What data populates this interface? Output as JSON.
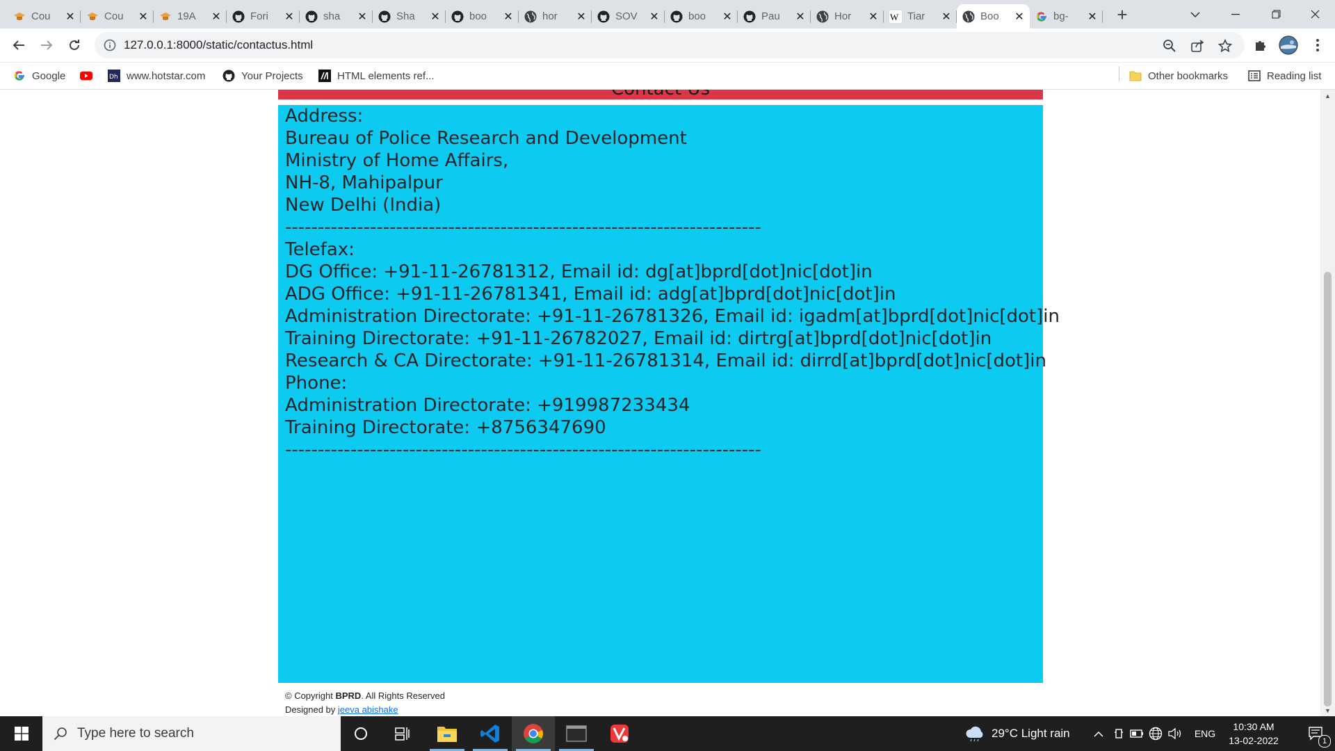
{
  "browser": {
    "tabs": [
      {
        "title": "Cou",
        "icon": "scholar-cap-icon",
        "active": false
      },
      {
        "title": "Cou",
        "icon": "scholar-cap-icon",
        "active": false
      },
      {
        "title": "19A",
        "icon": "scholar-cap-icon",
        "active": false
      },
      {
        "title": "Fori",
        "icon": "github-icon",
        "active": false
      },
      {
        "title": "sha",
        "icon": "github-icon",
        "active": false
      },
      {
        "title": "Sha",
        "icon": "github-icon",
        "active": false
      },
      {
        "title": "boo",
        "icon": "github-icon",
        "active": false
      },
      {
        "title": "hor",
        "icon": "globe-icon",
        "active": false
      },
      {
        "title": "SOV",
        "icon": "github-icon",
        "active": false
      },
      {
        "title": "boo",
        "icon": "github-icon",
        "active": false
      },
      {
        "title": "Pau",
        "icon": "github-icon",
        "active": false
      },
      {
        "title": "Hor",
        "icon": "globe-icon",
        "active": false
      },
      {
        "title": "Tiar",
        "icon": "wikipedia-icon",
        "active": false
      },
      {
        "title": "Boo",
        "icon": "globe-icon",
        "active": true
      },
      {
        "title": "bg-",
        "icon": "google-icon",
        "active": false
      }
    ],
    "url": "127.0.0.1:8000/static/contactus.html",
    "bookmarks": [
      {
        "label": "Google",
        "icon": "google-icon"
      },
      {
        "label": "",
        "icon": "youtube-icon"
      },
      {
        "label": "www.hotstar.com",
        "icon": "hotstar-icon"
      },
      {
        "label": "Your Projects",
        "icon": "github-icon"
      },
      {
        "label": "HTML elements ref...",
        "icon": "mdn-icon"
      }
    ],
    "other_bookmarks": "Other bookmarks",
    "reading_list": "Reading list"
  },
  "page": {
    "header_title": "Contact Us",
    "contact_lines": [
      "Address:",
      "Bureau of Police Research and Development",
      "Ministry of Home Affairs,",
      "NH-8, Mahipalpur",
      "New Delhi (India)",
      "-------------------------------------------------------------------------",
      "Telefax:",
      "DG Office: +91-11-26781312, Email id: dg[at]bprd[dot]nic[dot]in",
      "ADG Office: +91-11-26781341, Email id: adg[at]bprd[dot]nic[dot]in",
      "Administration Directorate: +91-11-26781326, Email id: igadm[at]bprd[dot]nic[dot]in",
      "Training Directorate: +91-11-26782027, Email id: dirtrg[at]bprd[dot]nic[dot]in",
      "Research & CA Directorate: +91-11-26781314, Email id: dirrd[at]bprd[dot]nic[dot]in",
      "Phone:",
      "Administration Directorate: +919987233434",
      "Training Directorate: +8756347690",
      "-------------------------------------------------------------------------"
    ],
    "footer": {
      "copyright_prefix": "© Copyright ",
      "copyright_brand": "BPRD",
      "copyright_suffix": ". All Rights Reserved",
      "designed_prefix": "Designed by ",
      "designer": "jeeva abishake"
    },
    "colors": {
      "header": "#dc3545",
      "contact_bg": "#0dcaf0"
    }
  },
  "taskbar": {
    "search_placeholder": "Type here to search",
    "weather": "29°C  Light rain",
    "language": "ENG",
    "time": "10:30 AM",
    "date": "13-02-2022",
    "notification_count": "1"
  }
}
